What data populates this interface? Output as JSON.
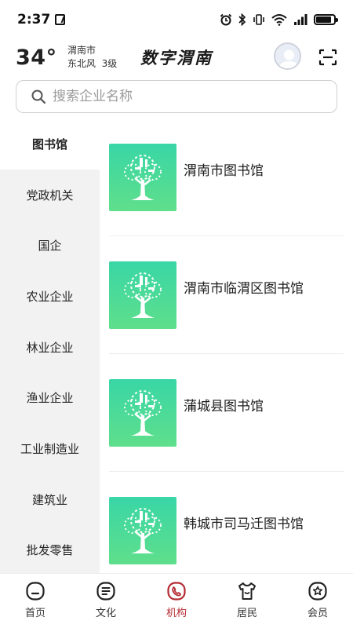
{
  "status_bar": {
    "time": "2:37",
    "icons": [
      "nfc-icon",
      "alarm-icon",
      "bluetooth-icon",
      "vibrate-icon",
      "wifi-icon",
      "signal-icon",
      "battery-icon"
    ]
  },
  "header": {
    "temperature": "34°",
    "city": "渭南市",
    "wind": "东北风  3级",
    "app_title": "数字渭南"
  },
  "search": {
    "placeholder": "搜索企业名称"
  },
  "sidebar": {
    "items": [
      {
        "label": "图书馆",
        "active": true
      },
      {
        "label": "党政机关"
      },
      {
        "label": "国企"
      },
      {
        "label": "农业企业"
      },
      {
        "label": "林业企业"
      },
      {
        "label": "渔业企业"
      },
      {
        "label": "工业制造业"
      },
      {
        "label": "建筑业"
      },
      {
        "label": "批发零售"
      }
    ]
  },
  "organizations": [
    {
      "name": "渭南市图书馆"
    },
    {
      "name": "渭南市临渭区图书馆"
    },
    {
      "name": "蒲城县图书馆"
    },
    {
      "name": "韩城市司马迁图书馆"
    }
  ],
  "bottom_nav": {
    "items": [
      {
        "label": "首页",
        "icon": "home-icon"
      },
      {
        "label": "文化",
        "icon": "culture-icon"
      },
      {
        "label": "机构",
        "icon": "institution-icon",
        "active": true
      },
      {
        "label": "居民",
        "icon": "resident-icon"
      },
      {
        "label": "会员",
        "icon": "member-icon"
      }
    ]
  },
  "colors": {
    "accent": "#b52b33",
    "thumb_green": "#4cdc98",
    "sidebar_bg": "#f2f2f2"
  }
}
